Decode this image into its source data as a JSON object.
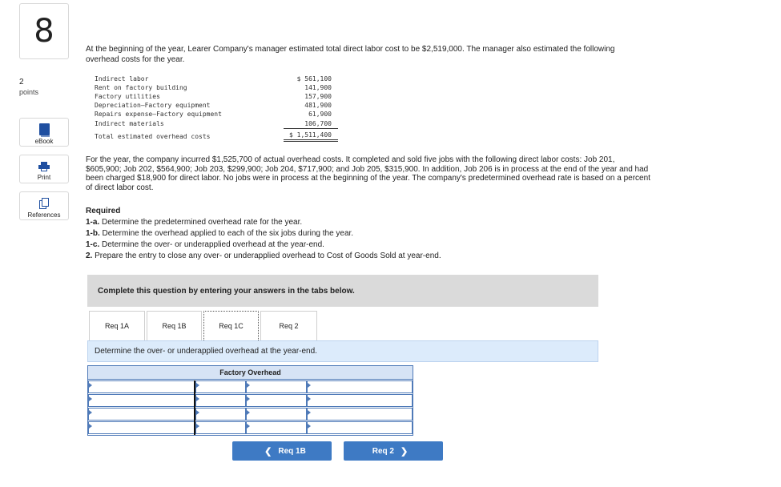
{
  "question": {
    "number": "8",
    "points_value": "2",
    "points_label": "points"
  },
  "sidebar": {
    "ebook_label": "eBook",
    "print_label": "Print",
    "references_label": "References"
  },
  "intro": "At the beginning of the year, Learer Company's manager estimated total direct labor cost to be $2,519,000. The manager also estimated the following overhead costs for the year.",
  "overhead_costs": [
    {
      "label": "Indirect labor",
      "amount": "$ 561,100"
    },
    {
      "label": "Rent on factory building",
      "amount": "141,900"
    },
    {
      "label": "Factory utilities",
      "amount": "157,900"
    },
    {
      "label": "Depreciation—Factory equipment",
      "amount": "481,900"
    },
    {
      "label": "Repairs expense—Factory equipment",
      "amount": "61,900"
    },
    {
      "label": "Indirect materials",
      "amount": "106,700"
    }
  ],
  "overhead_total": {
    "label": "Total estimated overhead costs",
    "amount": "$ 1,511,400"
  },
  "paragraph2": "For the year, the company incurred $1,525,700 of actual overhead costs. It completed and sold five jobs with the following direct labor costs: Job 201, $605,900; Job 202, $564,900; Job 203, $299,900; Job 204, $717,900; and Job 205, $315,900. In addition, Job 206 is in process at the end of the year and had been charged $18,900 for direct labor. No jobs were in process at the beginning of the year. The company's predetermined overhead rate is based on a percent of direct labor cost.",
  "required": {
    "title": "Required",
    "items": [
      {
        "tag": "1-a.",
        "text": " Determine the predetermined overhead rate for the year."
      },
      {
        "tag": "1-b.",
        "text": " Determine the overhead applied to each of the six jobs during the year."
      },
      {
        "tag": "1-c.",
        "text": " Determine the over- or underapplied overhead at the year-end."
      },
      {
        "tag": "2.",
        "text": " Prepare the entry to close any over- or underapplied overhead to Cost of Goods Sold at year-end."
      }
    ]
  },
  "instructions": "Complete this question by entering your answers in the tabs below.",
  "tabs": [
    {
      "label": "Req 1A"
    },
    {
      "label": "Req 1B"
    },
    {
      "label": "Req 1C"
    },
    {
      "label": "Req 2"
    }
  ],
  "active_tab": "Req 1C",
  "task": "Determine the over- or underapplied overhead at the year-end.",
  "t_account": {
    "title": "Factory Overhead"
  },
  "nav": {
    "prev_label": "Req 1B",
    "next_label": "Req 2"
  },
  "colors": {
    "accent": "#3e7ac4",
    "task_bg": "#dcebfb",
    "instr_bg": "#dadada",
    "t_border": "#4f7ab8"
  }
}
